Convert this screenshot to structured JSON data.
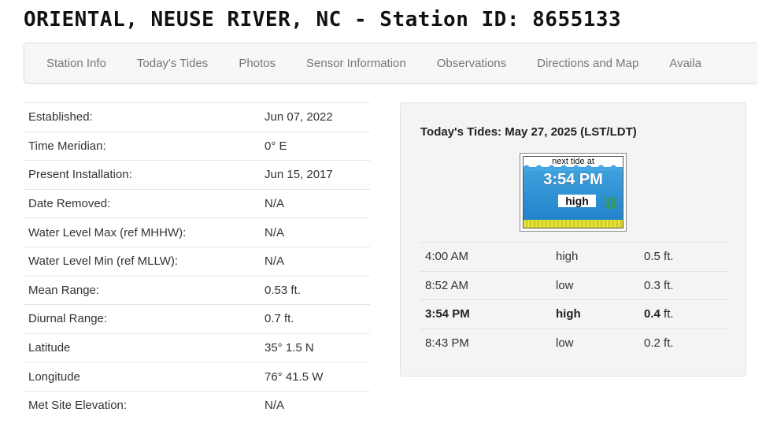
{
  "page_title": "ORIENTAL, NEUSE RIVER, NC - Station ID: 8655133",
  "nav": {
    "items": [
      "Station Info",
      "Today's Tides",
      "Photos",
      "Sensor Information",
      "Observations",
      "Directions and Map",
      "Availa"
    ]
  },
  "station_info": [
    {
      "label": "Established:",
      "value": "Jun 07, 2022"
    },
    {
      "label": "Time Meridian:",
      "value": "0° E"
    },
    {
      "label": "Present Installation:",
      "value": "Jun 15, 2017"
    },
    {
      "label": "Date Removed:",
      "value": "N/A"
    },
    {
      "label": "Water Level Max (ref MHHW):",
      "value": "N/A"
    },
    {
      "label": "Water Level Min (ref MLLW):",
      "value": "N/A"
    },
    {
      "label": "Mean Range:",
      "value": "0.53 ft."
    },
    {
      "label": "Diurnal Range:",
      "value": "0.7 ft."
    },
    {
      "label": "Latitude",
      "value": "35° 1.5 N"
    },
    {
      "label": "Longitude",
      "value": "76° 41.5 W"
    },
    {
      "label": "Met Site Elevation:",
      "value": "N/A"
    }
  ],
  "tides": {
    "title": "Today's Tides: May 27, 2025 (LST/LDT)",
    "widget": {
      "label": "next tide at",
      "time": "3:54 PM",
      "type": "high"
    },
    "rows": [
      {
        "time": "4:00 AM",
        "type": "high",
        "height": "0.5",
        "unit": "ft."
      },
      {
        "time": "8:52 AM",
        "type": "low",
        "height": "0.3",
        "unit": "ft."
      },
      {
        "time": "3:54 PM",
        "type": "high",
        "height": "0.4",
        "unit": "ft."
      },
      {
        "time": "8:43 PM",
        "type": "low",
        "height": "0.2",
        "unit": "ft."
      }
    ],
    "next_index": 2
  },
  "colors": {
    "water": "#1e7fc7",
    "sand": "#e2e23a",
    "panel_bg": "#f4f4f4"
  }
}
